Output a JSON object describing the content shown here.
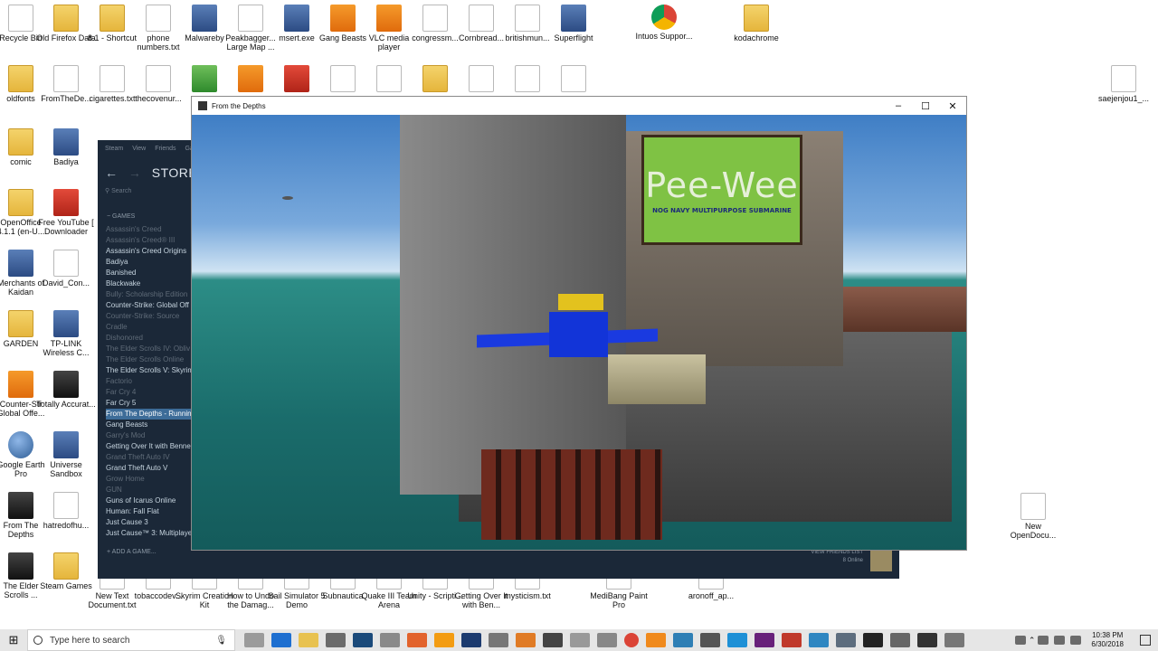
{
  "desktop": {
    "top_row": [
      {
        "label": "Recycle Bin",
        "icon": "recycle-bin-icon",
        "kind": "doc"
      },
      {
        "label": "Old Firefox Data",
        "icon": "folder-icon",
        "kind": "folder"
      },
      {
        "label": "8.1 - Shortcut",
        "icon": "folder-icon",
        "kind": "folder"
      },
      {
        "label": "phone numbers.txt",
        "icon": "text-file-icon",
        "kind": "doc"
      },
      {
        "label": "Malwareby",
        "icon": "malwarebytes-icon",
        "kind": "app"
      },
      {
        "label": "Peakbagger... Large Map ...",
        "icon": "webpage-icon",
        "kind": "doc"
      },
      {
        "label": "msert.exe",
        "icon": "msert-icon",
        "kind": "app"
      },
      {
        "label": "Gang Beasts",
        "icon": "gang-beasts-icon",
        "kind": "orange"
      },
      {
        "label": "VLC media player",
        "icon": "vlc-icon",
        "kind": "orange"
      },
      {
        "label": "congressm...",
        "icon": "text-file-icon",
        "kind": "doc"
      },
      {
        "label": "Cornbread...",
        "icon": "document-icon",
        "kind": "doc"
      },
      {
        "label": "britishmun...",
        "icon": "text-file-icon",
        "kind": "doc"
      },
      {
        "label": "Superflight",
        "icon": "superflight-icon",
        "kind": "app"
      },
      {
        "label": "Intuos Suppor...",
        "icon": "chrome-icon",
        "kind": "chrome"
      },
      {
        "label": "kodachrome",
        "icon": "folder-icon",
        "kind": "folder"
      }
    ],
    "second_row": [
      {
        "label": "oldfonts",
        "icon": "folder-icon",
        "kind": "folder"
      },
      {
        "label": "FromTheDe...",
        "icon": "document-icon",
        "kind": "doc"
      },
      {
        "label": "cigarettes.txt",
        "icon": "text-file-icon",
        "kind": "doc"
      },
      {
        "label": "thecovenur...",
        "icon": "text-file-icon",
        "kind": "doc"
      },
      {
        "label": "",
        "icon": "utorrent-icon",
        "kind": "green"
      },
      {
        "label": "",
        "icon": "zoom-icon",
        "kind": "orange"
      },
      {
        "label": "",
        "icon": "pdf-icon",
        "kind": "red"
      },
      {
        "label": "",
        "icon": "text-file-icon",
        "kind": "doc"
      },
      {
        "label": "",
        "icon": "text-file-icon",
        "kind": "doc"
      },
      {
        "label": "",
        "icon": "archive-icon",
        "kind": "folder"
      },
      {
        "label": "",
        "icon": "image-file-icon",
        "kind": "doc"
      },
      {
        "label": "",
        "icon": "text-file-icon",
        "kind": "doc"
      },
      {
        "label": "",
        "icon": "text-file-icon",
        "kind": "doc"
      }
    ],
    "left_column": [
      {
        "label": "comic",
        "icon": "folder-icon",
        "kind": "folder"
      },
      {
        "label": "Badiya",
        "icon": "badiya-icon",
        "kind": "app"
      },
      {
        "label": "OpenOffice 4.1.1 (en-U...",
        "icon": "folder-icon",
        "kind": "folder"
      },
      {
        "label": "Free YouTube [ Downloader",
        "icon": "youtube-downloader-icon",
        "kind": "red"
      },
      {
        "label": "Merchants of Kaidan",
        "icon": "merchants-icon",
        "kind": "app"
      },
      {
        "label": "David_Con...",
        "icon": "text-file-icon",
        "kind": "doc"
      },
      {
        "label": "GARDEN",
        "icon": "folder-icon",
        "kind": "folder"
      },
      {
        "label": "TP-LINK Wireless C...",
        "icon": "tplink-icon",
        "kind": "app"
      },
      {
        "label": "Counter-Str Global Offe...",
        "icon": "csgo-icon",
        "kind": "orange"
      },
      {
        "label": "Totally Accurat...",
        "icon": "unity-icon",
        "kind": "dark"
      },
      {
        "label": "Google Earth Pro",
        "icon": "google-earth-icon",
        "kind": "earth"
      },
      {
        "label": "Universe Sandbox",
        "icon": "universe-sandbox-icon",
        "kind": "app"
      },
      {
        "label": "From The Depths",
        "icon": "from-the-depths-icon",
        "kind": "dark"
      },
      {
        "label": "hatredofhu...",
        "icon": "text-file-icon",
        "kind": "doc"
      },
      {
        "label": "The Elder Scrolls ...",
        "icon": "elder-scrolls-icon",
        "kind": "dark"
      },
      {
        "label": "Steam Games",
        "icon": "folder-icon",
        "kind": "folder"
      }
    ],
    "bottom_row": [
      {
        "label": "New Text Document.txt",
        "icon": "text-file-icon"
      },
      {
        "label": "tobaccodev...",
        "icon": "text-file-icon"
      },
      {
        "label": "Skyrim Creation Kit",
        "icon": "skyrim-icon"
      },
      {
        "label": "How to Undo the Damag...",
        "icon": "document-icon"
      },
      {
        "label": "Sail Simulator 5 Demo",
        "icon": "sail-icon"
      },
      {
        "label": "Subnautica",
        "icon": "subnautica-icon"
      },
      {
        "label": "Quake III Team Arena",
        "icon": "quake-icon"
      },
      {
        "label": "Unity - Scripti...",
        "icon": "unity-icon"
      },
      {
        "label": "Getting Over It with Ben...",
        "icon": "getting-over-it-icon"
      },
      {
        "label": "mysticism.txt",
        "icon": "text-file-icon"
      },
      {
        "label": "MediBang Paint Pro",
        "icon": "medibang-icon"
      },
      {
        "label": "aronoff_ap...",
        "icon": "document-icon"
      }
    ],
    "right_icons": [
      {
        "label": "saejenjou1_...",
        "icon": "image-file-icon"
      },
      {
        "label": "New OpenDocu...",
        "icon": "document-icon"
      }
    ]
  },
  "steam": {
    "menu": [
      "Steam",
      "View",
      "Friends",
      "Ga"
    ],
    "store_label": "STORE",
    "search_placeholder": "Search",
    "games_header": "GAMES",
    "games": [
      {
        "name": "Assassin's Creed",
        "state": "dim"
      },
      {
        "name": "Assassin's Creed® III",
        "state": "dim"
      },
      {
        "name": "Assassin's Creed Origins",
        "state": "normal"
      },
      {
        "name": "Badiya",
        "state": "normal"
      },
      {
        "name": "Banished",
        "state": "normal"
      },
      {
        "name": "Blackwake",
        "state": "normal"
      },
      {
        "name": "Bully: Scholarship Edition",
        "state": "dim"
      },
      {
        "name": "Counter-Strike: Global Off",
        "state": "normal"
      },
      {
        "name": "Counter-Strike: Source",
        "state": "dim"
      },
      {
        "name": "Cradle",
        "state": "dim"
      },
      {
        "name": "Dishonored",
        "state": "dim"
      },
      {
        "name": "The Elder Scrolls IV: Obliv",
        "state": "dim"
      },
      {
        "name": "The Elder Scrolls Online",
        "state": "dim"
      },
      {
        "name": "The Elder Scrolls V: Skyrim",
        "state": "normal"
      },
      {
        "name": "Factorio",
        "state": "dim"
      },
      {
        "name": "Far Cry 4",
        "state": "dim"
      },
      {
        "name": "Far Cry 5",
        "state": "normal"
      },
      {
        "name": "From The Depths - Runnin",
        "state": "sel"
      },
      {
        "name": "Gang Beasts",
        "state": "normal"
      },
      {
        "name": "Garry's Mod",
        "state": "dim"
      },
      {
        "name": "Getting Over It with Benne",
        "state": "normal"
      },
      {
        "name": "Grand Theft Auto IV",
        "state": "dim"
      },
      {
        "name": "Grand Theft Auto V",
        "state": "normal"
      },
      {
        "name": "Grow Home",
        "state": "dim"
      },
      {
        "name": "GUN",
        "state": "dim"
      },
      {
        "name": "Guns of Icarus Online",
        "state": "normal"
      },
      {
        "name": "Human: Fall Flat",
        "state": "normal"
      },
      {
        "name": "Just Cause 3",
        "state": "normal"
      },
      {
        "name": "Just Cause™ 3: Multiplaye",
        "state": "normal"
      }
    ],
    "add_game": "ADD A GAME...",
    "friends_list": "VIEW FRIENDS LIST",
    "friends_online": "8 Online"
  },
  "game_window": {
    "title": "From the Depths",
    "minimize": "–",
    "maximize": "☐",
    "close": "✕",
    "billboard_title": "Pee-Wee",
    "billboard_subtitle": "NOG NAVY MULTIPURPOSE SUBMARINE"
  },
  "taskbar": {
    "start_icon": "windows-icon",
    "search_placeholder": "Type here to search",
    "clock_time": "10:38 PM",
    "clock_date": "6/30/2018"
  },
  "colors": {
    "steam_bg": "#1b2838",
    "selected_game": "#3d6c98",
    "taskbar_bg": "#e6e6e6"
  }
}
